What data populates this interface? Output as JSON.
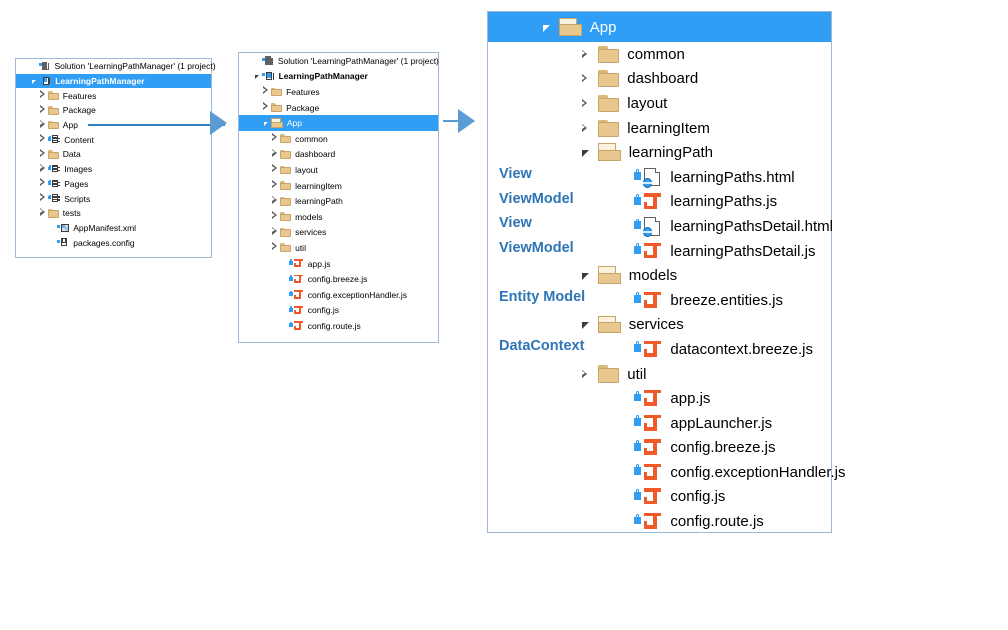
{
  "colors": {
    "selection_blue": "#2f9ef4",
    "annotation_blue": "#2e75b6",
    "arrow_blue": "#5b9bd5",
    "panel_border": "#9db9d6",
    "folder_tan": "#e8c88f",
    "js_orange": "#f05a28"
  },
  "left_panel": {
    "name": "solution-explorer-collapsed",
    "solution_row": {
      "label": "Solution 'LearningPathManager' (1 project)",
      "icon": "solution-icon"
    },
    "project_row": {
      "label": "LearningPathManager",
      "icon": "project-icon",
      "state": "expanded",
      "selected": true
    },
    "items": [
      {
        "label": "Features",
        "icon": "folder-icon",
        "state": "collapsed",
        "depth": 2
      },
      {
        "label": "Package",
        "icon": "folder-icon",
        "state": "collapsed",
        "depth": 2
      },
      {
        "label": "App",
        "icon": "folder-icon",
        "state": "collapsed",
        "depth": 2,
        "callout": true
      },
      {
        "label": "Content",
        "icon": "special-folder-icon",
        "state": "collapsed",
        "depth": 2
      },
      {
        "label": "Data",
        "icon": "folder-icon",
        "state": "collapsed",
        "depth": 2
      },
      {
        "label": "Images",
        "icon": "special-folder-icon",
        "state": "collapsed",
        "depth": 2
      },
      {
        "label": "Pages",
        "icon": "special-folder-icon",
        "state": "collapsed",
        "depth": 2
      },
      {
        "label": "Scripts",
        "icon": "special-folder-icon",
        "state": "collapsed",
        "depth": 2
      },
      {
        "label": "tests",
        "icon": "folder-icon",
        "state": "collapsed",
        "depth": 2
      },
      {
        "label": "AppManifest.xml",
        "icon": "xml-file-icon",
        "state": "leaf",
        "depth": 3
      },
      {
        "label": "packages.config",
        "icon": "config-file-icon",
        "state": "leaf",
        "depth": 3
      }
    ]
  },
  "middle_panel": {
    "name": "solution-explorer-app-expanded",
    "solution_row": {
      "label": "Solution 'LearningPathManager' (1 project)",
      "icon": "solution-icon"
    },
    "project_row": {
      "label": "LearningPathManager",
      "icon": "project-icon",
      "state": "expanded"
    },
    "items": [
      {
        "label": "Features",
        "icon": "folder-icon",
        "state": "collapsed",
        "depth": 2
      },
      {
        "label": "Package",
        "icon": "folder-icon",
        "state": "collapsed",
        "depth": 2
      },
      {
        "label": "App",
        "icon": "folder-open-icon",
        "state": "expanded",
        "depth": 2,
        "selected": true
      },
      {
        "label": "common",
        "icon": "folder-icon",
        "state": "collapsed",
        "depth": 3
      },
      {
        "label": "dashboard",
        "icon": "folder-icon",
        "state": "collapsed",
        "depth": 3
      },
      {
        "label": "layout",
        "icon": "folder-icon",
        "state": "collapsed",
        "depth": 3
      },
      {
        "label": "learningItem",
        "icon": "folder-icon",
        "state": "collapsed",
        "depth": 3
      },
      {
        "label": "learningPath",
        "icon": "folder-icon",
        "state": "collapsed",
        "depth": 3
      },
      {
        "label": "models",
        "icon": "folder-icon",
        "state": "collapsed",
        "depth": 3
      },
      {
        "label": "services",
        "icon": "folder-icon",
        "state": "collapsed",
        "depth": 3
      },
      {
        "label": "util",
        "icon": "folder-icon",
        "state": "collapsed",
        "depth": 3
      },
      {
        "label": "app.js",
        "icon": "js-file-icon",
        "state": "leaf",
        "depth": 4
      },
      {
        "label": "config.breeze.js",
        "icon": "js-file-icon",
        "state": "leaf",
        "depth": 4
      },
      {
        "label": "config.exceptionHandler.js",
        "icon": "js-file-icon",
        "state": "leaf",
        "depth": 4
      },
      {
        "label": "config.js",
        "icon": "js-file-icon",
        "state": "leaf",
        "depth": 4
      },
      {
        "label": "config.route.js",
        "icon": "js-file-icon",
        "state": "leaf",
        "depth": 4
      }
    ]
  },
  "right_panel": {
    "name": "app-folder-detail-tree",
    "header": {
      "label": "App",
      "icon": "folder-open-icon",
      "state": "expanded",
      "selected": true
    },
    "items": [
      {
        "label": "common",
        "icon": "folder-icon",
        "state": "collapsed",
        "depth": 1,
        "annotation": ""
      },
      {
        "label": "dashboard",
        "icon": "folder-icon",
        "state": "collapsed",
        "depth": 1,
        "annotation": ""
      },
      {
        "label": "layout",
        "icon": "folder-icon",
        "state": "collapsed",
        "depth": 1,
        "annotation": ""
      },
      {
        "label": "learningItem",
        "icon": "folder-icon",
        "state": "collapsed",
        "depth": 1,
        "annotation": ""
      },
      {
        "label": "learningPath",
        "icon": "folder-open-icon",
        "state": "expanded",
        "depth": 1,
        "annotation": ""
      },
      {
        "label": "learningPaths.html",
        "icon": "html-file-icon",
        "state": "leaf",
        "depth": 2,
        "annotation": "View"
      },
      {
        "label": "learningPaths.js",
        "icon": "js-file-icon",
        "state": "leaf",
        "depth": 2,
        "annotation": "ViewModel"
      },
      {
        "label": "learningPathsDetail.html",
        "icon": "html-file-icon",
        "state": "leaf",
        "depth": 2,
        "annotation": "View"
      },
      {
        "label": "learningPathsDetail.js",
        "icon": "js-file-icon",
        "state": "leaf",
        "depth": 2,
        "annotation": "ViewModel"
      },
      {
        "label": "models",
        "icon": "folder-open-icon",
        "state": "expanded",
        "depth": 1,
        "annotation": ""
      },
      {
        "label": "breeze.entities.js",
        "icon": "js-file-icon",
        "state": "leaf",
        "depth": 2,
        "annotation": "Entity Model"
      },
      {
        "label": "services",
        "icon": "folder-open-icon",
        "state": "expanded",
        "depth": 1,
        "annotation": ""
      },
      {
        "label": "datacontext.breeze.js",
        "icon": "js-file-icon",
        "state": "leaf",
        "depth": 2,
        "annotation": "DataContext"
      },
      {
        "label": "util",
        "icon": "folder-icon",
        "state": "collapsed",
        "depth": 1,
        "annotation": ""
      },
      {
        "label": "app.js",
        "icon": "js-file-icon",
        "state": "leaf",
        "depth": 2,
        "annotation": ""
      },
      {
        "label": "appLauncher.js",
        "icon": "js-file-icon",
        "state": "leaf",
        "depth": 2,
        "annotation": ""
      },
      {
        "label": "config.breeze.js",
        "icon": "js-file-icon",
        "state": "leaf",
        "depth": 2,
        "annotation": ""
      },
      {
        "label": "config.exceptionHandler.js",
        "icon": "js-file-icon",
        "state": "leaf",
        "depth": 2,
        "annotation": ""
      },
      {
        "label": "config.js",
        "icon": "js-file-icon",
        "state": "leaf",
        "depth": 2,
        "annotation": ""
      },
      {
        "label": "config.route.js",
        "icon": "js-file-icon",
        "state": "leaf",
        "depth": 2,
        "annotation": ""
      }
    ]
  },
  "connectors": [
    {
      "name": "arrow-left-to-middle"
    },
    {
      "name": "arrow-middle-to-right"
    }
  ]
}
